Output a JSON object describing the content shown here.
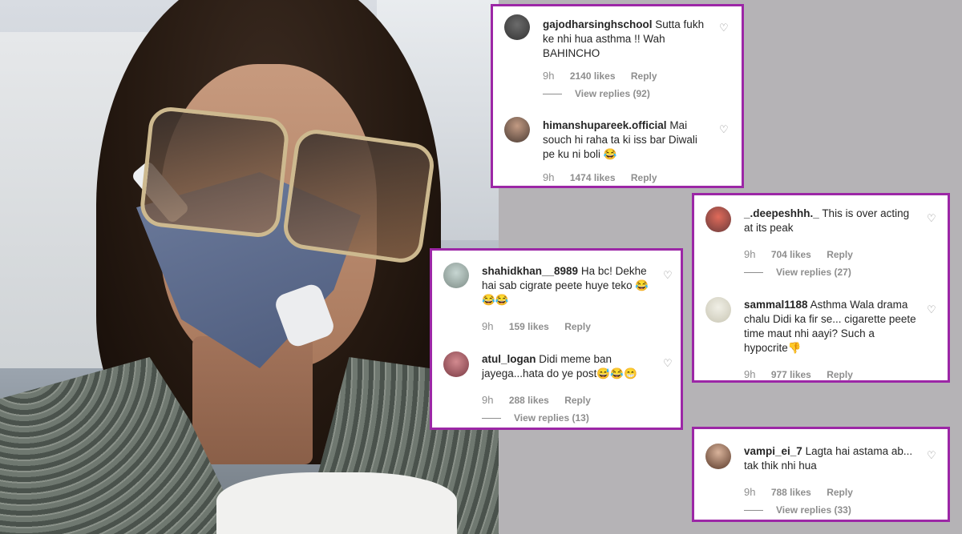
{
  "colors": {
    "frame": "#9c27a6",
    "muted": "#8e8e8e",
    "text": "#262626",
    "background": "#b5b3b6"
  },
  "icons": {
    "like": "heart-outline",
    "emoji_laugh": "face-with-tears-of-joy",
    "emoji_grin": "grinning-face",
    "emoji_down": "thumbs-down"
  },
  "box1": {
    "c1": {
      "username": "gajodharsinghschool",
      "text": "Sutta fukh ke nhi hua asthma !! Wah BAHINCHO",
      "age": "9h",
      "likes": "2140 likes",
      "reply": "Reply",
      "view_replies": "View replies (92)"
    },
    "c2": {
      "username": "himanshupareek.official",
      "text": "Mai souch hi raha ta ki iss bar Diwali pe ku ni boli 😂",
      "age": "9h",
      "likes": "1474 likes",
      "reply": "Reply"
    }
  },
  "box2": {
    "c1": {
      "username": "shahidkhan__8989",
      "text": "Ha bc! Dekhe hai sab cigrate peete huye teko 😂😂😂",
      "age": "9h",
      "likes": "159 likes",
      "reply": "Reply"
    },
    "c2": {
      "username": "atul_logan",
      "text": "Didi meme ban jayega...hata do ye post😅😂😁",
      "age": "9h",
      "likes": "288 likes",
      "reply": "Reply",
      "view_replies": "View replies (13)"
    }
  },
  "box3": {
    "c1": {
      "username": "_.deepeshhh._",
      "text": "This is over acting at its peak",
      "age": "9h",
      "likes": "704 likes",
      "reply": "Reply",
      "view_replies": "View replies (27)"
    },
    "c2": {
      "username": "sammal1188",
      "text": "Asthma Wala drama chalu Didi ka fir se... cigarette peete time maut nhi aayi? Such a hypocrite👎",
      "age": "9h",
      "likes": "977 likes",
      "reply": "Reply"
    }
  },
  "box4": {
    "c1": {
      "username": "vampi_ei_7",
      "text": "Lagta hai astama ab... tak thik nhi hua",
      "age": "9h",
      "likes": "788 likes",
      "reply": "Reply",
      "view_replies": "View replies (33)"
    }
  }
}
